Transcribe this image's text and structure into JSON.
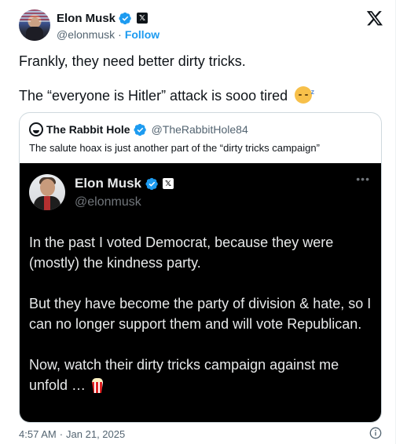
{
  "author": {
    "name": "Elon Musk",
    "handle": "@elonmusk",
    "separator": "·",
    "follow_label": "Follow",
    "verified_badge_icon": "verified-check-icon",
    "affiliation_icon": "x-logo-icon"
  },
  "tweet": {
    "line1": "Frankly, they need better dirty tricks.",
    "line2": "The “everyone is Hitler” attack is sooo tired",
    "emoji": "sleeping-face-icon"
  },
  "quoted": {
    "name": "The Rabbit Hole",
    "handle": "@TheRabbitHole84",
    "text": "The salute hoax is just another part of the “dirty tricks campaign”",
    "embedded_post": {
      "name": "Elon Musk",
      "handle": "@elonmusk",
      "more_label": "•••",
      "paragraphs": [
        "In the past I voted Democrat, because they were (mostly) the kindness party.",
        "But they have become the party of division & hate, so I can no longer support them and will vote Republican.",
        "Now, watch their dirty tricks campaign against me unfold …"
      ],
      "emoji": "popcorn-icon"
    }
  },
  "footer": {
    "time": "4:57 AM",
    "separator": "·",
    "date": "Jan 21, 2025"
  },
  "colors": {
    "accent": "#1d9bf0",
    "text": "#0f1419",
    "muted": "#536471",
    "dark_bg": "#000000"
  }
}
